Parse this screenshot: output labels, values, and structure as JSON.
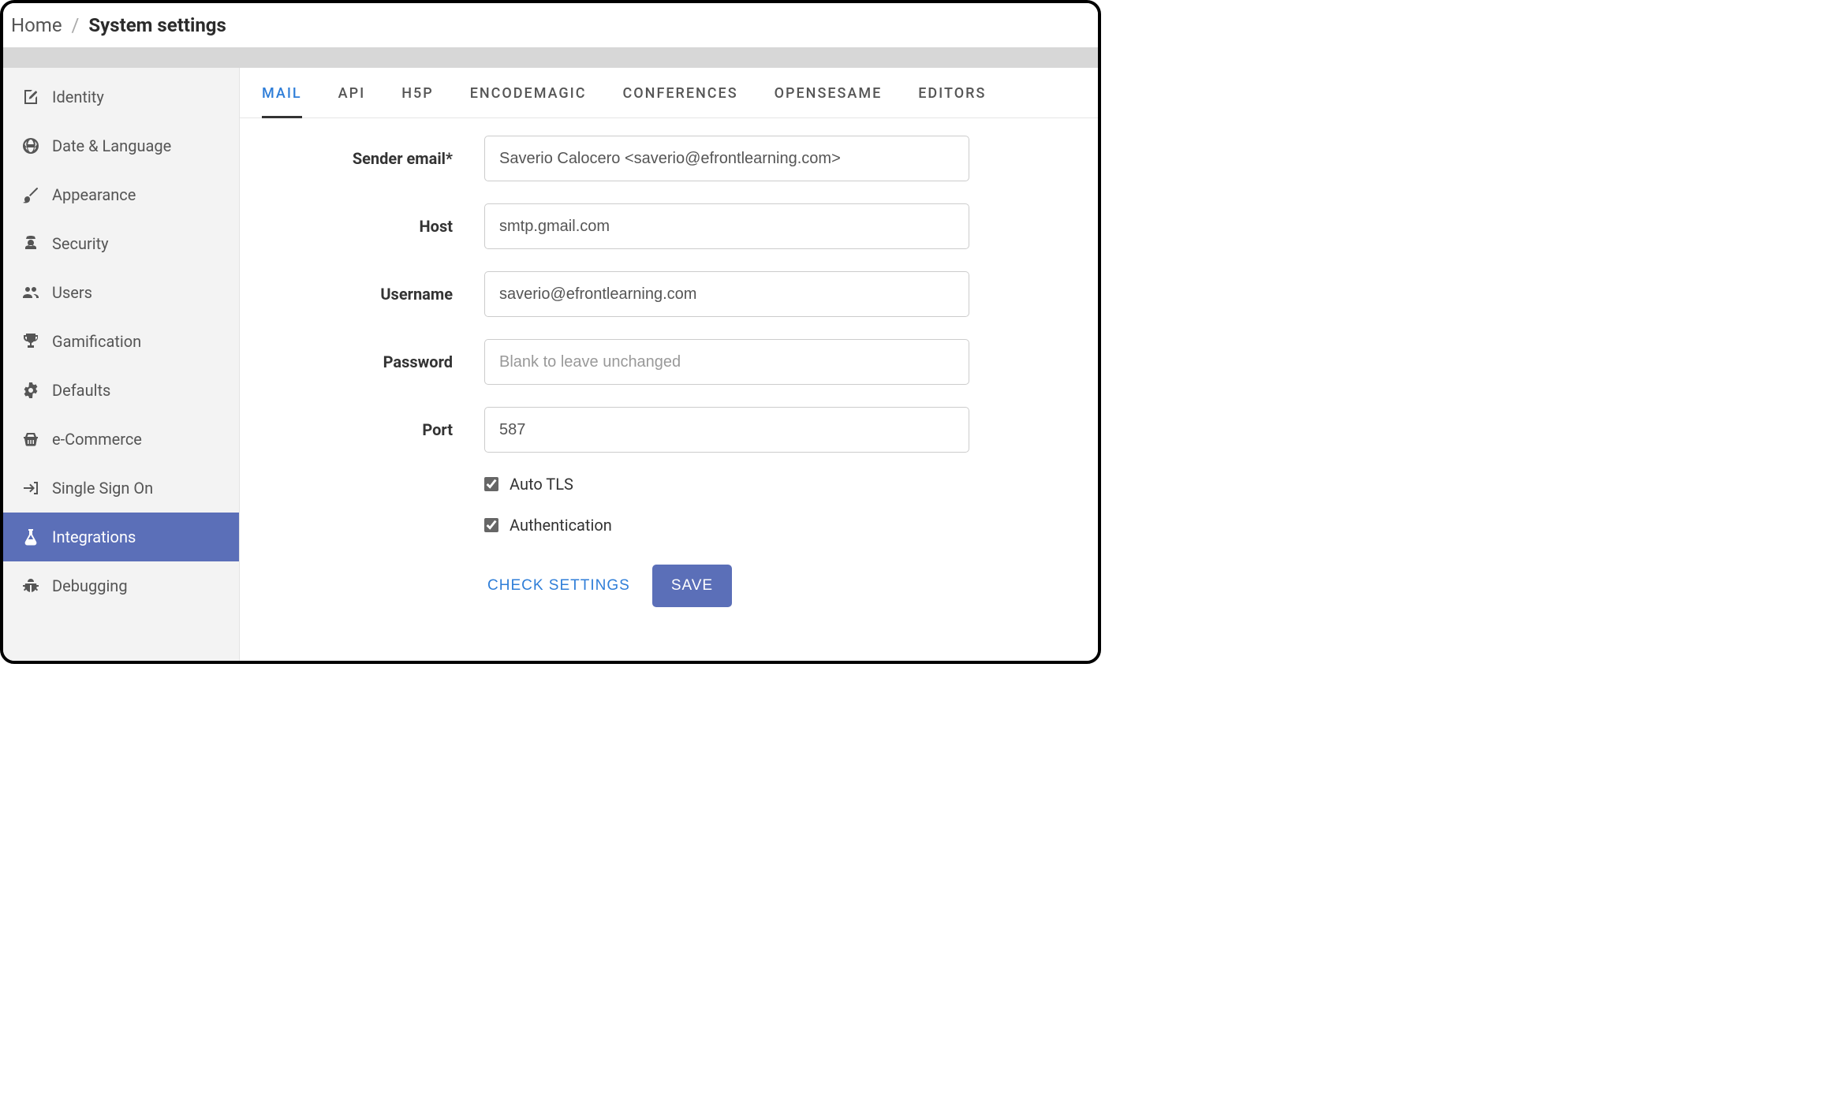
{
  "breadcrumb": {
    "home": "Home",
    "sep": "/",
    "current": "System settings"
  },
  "sidebar": {
    "items": [
      {
        "id": "identity",
        "label": "Identity",
        "icon": "document-edit-icon"
      },
      {
        "id": "datelang",
        "label": "Date & Language",
        "icon": "globe-icon"
      },
      {
        "id": "appearance",
        "label": "Appearance",
        "icon": "brush-icon"
      },
      {
        "id": "security",
        "label": "Security",
        "icon": "agent-icon"
      },
      {
        "id": "users",
        "label": "Users",
        "icon": "users-icon"
      },
      {
        "id": "gamification",
        "label": "Gamification",
        "icon": "trophy-icon"
      },
      {
        "id": "defaults",
        "label": "Defaults",
        "icon": "gears-icon"
      },
      {
        "id": "ecommerce",
        "label": "e-Commerce",
        "icon": "basket-icon"
      },
      {
        "id": "sso",
        "label": "Single Sign On",
        "icon": "arrow-right-bracket-icon"
      },
      {
        "id": "integrations",
        "label": "Integrations",
        "icon": "flask-icon",
        "active": true
      },
      {
        "id": "debugging",
        "label": "Debugging",
        "icon": "bug-icon"
      }
    ]
  },
  "tabs": [
    {
      "id": "mail",
      "label": "MAIL",
      "active": true
    },
    {
      "id": "api",
      "label": "API"
    },
    {
      "id": "h5p",
      "label": "H5P"
    },
    {
      "id": "encodemagic",
      "label": "ENCODEMAGIC"
    },
    {
      "id": "conferences",
      "label": "CONFERENCES"
    },
    {
      "id": "opensesame",
      "label": "OPENSESAME"
    },
    {
      "id": "editors",
      "label": "EDITORS"
    }
  ],
  "form": {
    "sender_email": {
      "label": "Sender email*",
      "value": "Saverio Calocero <saverio@efrontlearning.com>"
    },
    "host": {
      "label": "Host",
      "value": "smtp.gmail.com"
    },
    "username": {
      "label": "Username",
      "value": "saverio@efrontlearning.com"
    },
    "password": {
      "label": "Password",
      "value": "",
      "placeholder": "Blank to leave unchanged"
    },
    "port": {
      "label": "Port",
      "value": "587"
    },
    "auto_tls": {
      "label": "Auto TLS",
      "checked": true
    },
    "auth": {
      "label": "Authentication",
      "checked": true
    }
  },
  "actions": {
    "check": "CHECK SETTINGS",
    "save": "SAVE"
  },
  "colors": {
    "accent": "#5b6fb8",
    "link": "#2f7ed8"
  }
}
